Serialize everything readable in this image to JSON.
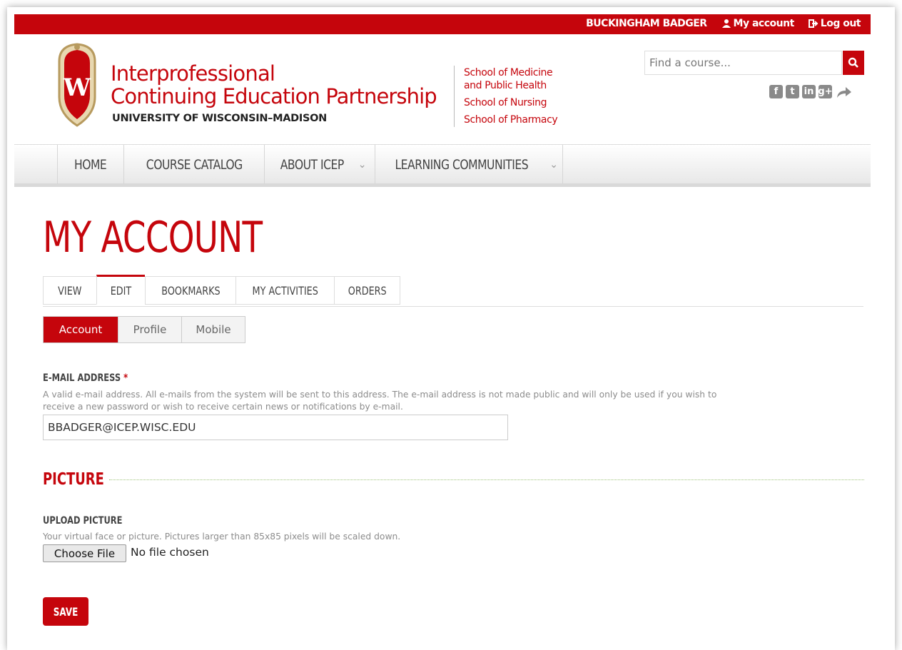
{
  "topbar": {
    "user_name": "BUCKINGHAM BADGER",
    "my_account": "My account",
    "log_out": "Log out"
  },
  "header": {
    "brand_line1": "Interprofessional",
    "brand_line2": "Continuing Education Partnership",
    "brand_line3": "UNIVERSITY OF WISCONSIN–MADISON",
    "crest_letter": "W",
    "schools": [
      "School of Medicine",
      "and Public Health",
      "School of Nursing",
      "School of Pharmacy"
    ],
    "search_placeholder": "Find a course...",
    "social_icons": [
      "facebook-icon",
      "twitter-icon",
      "linkedin-icon",
      "google-plus-icon",
      "share-icon"
    ]
  },
  "nav": {
    "items": [
      {
        "label": "HOME",
        "dropdown": false
      },
      {
        "label": "COURSE CATALOG",
        "dropdown": false
      },
      {
        "label": "ABOUT ICEP",
        "dropdown": true
      },
      {
        "label": "LEARNING COMMUNITIES",
        "dropdown": true
      }
    ]
  },
  "page": {
    "title": "MY ACCOUNT",
    "tabs": [
      "VIEW",
      "EDIT",
      "BOOKMARKS",
      "MY ACTIVITIES",
      "ORDERS"
    ],
    "active_tab": "EDIT",
    "subtabs": [
      "Account",
      "Profile",
      "Mobile"
    ],
    "active_subtab": "Account"
  },
  "form": {
    "email_label": "E-MAIL ADDRESS",
    "required_mark": "*",
    "email_desc_line1": "A valid e-mail address. All e-mails from the system will be sent to this address. The e-mail address is not made public and will only be used if you wish to",
    "email_desc_line2": "receive a new password or wish to receive certain news or notifications by e-mail.",
    "email_value": "BBADGER@ICEP.WISC.EDU",
    "picture_heading": "PICTURE",
    "upload_label": "UPLOAD PICTURE",
    "upload_desc": "Your virtual face or picture. Pictures larger than 85x85 pixels will be scaled down.",
    "choose_file": "Choose File",
    "file_status": "No file chosen",
    "save": "SAVE"
  },
  "colors": {
    "brand_red": "#c5050c"
  }
}
